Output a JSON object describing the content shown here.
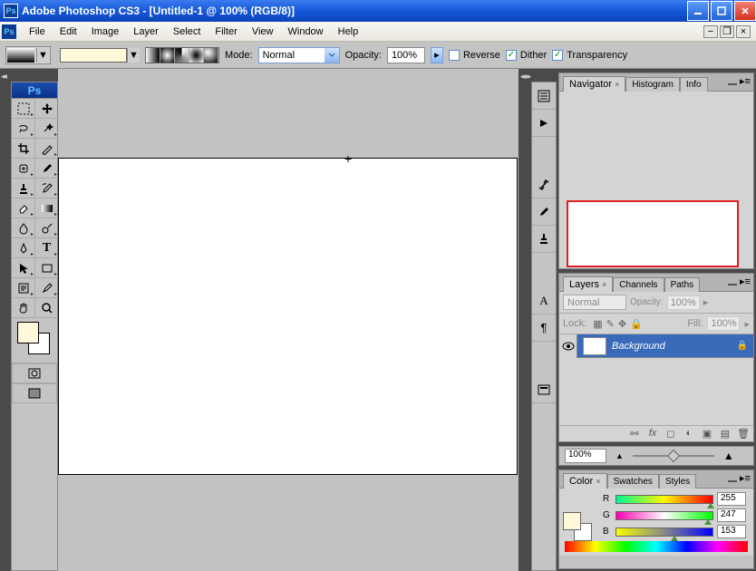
{
  "title": "Adobe Photoshop CS3 - [Untitled-1 @ 100% (RGB/8)]",
  "menu": [
    "File",
    "Edit",
    "Image",
    "Layer",
    "Select",
    "Filter",
    "View",
    "Window",
    "Help"
  ],
  "options": {
    "mode_label": "Mode:",
    "mode_value": "Normal",
    "opacity_label": "Opacity:",
    "opacity_value": "100%",
    "reverse": "Reverse",
    "dither": "Dither",
    "transparency": "Transparency"
  },
  "nav_tabs": [
    "Navigator",
    "Histogram",
    "Info"
  ],
  "layers_panel": {
    "tabs": [
      "Layers",
      "Channels",
      "Paths"
    ],
    "blend_mode": "Normal",
    "opacity_label": "Opacity:",
    "opacity_value": "100%",
    "lock_label": "Lock:",
    "fill_label": "Fill:",
    "fill_value": "100%",
    "layer_name": "Background"
  },
  "zoom": "100%",
  "color_panel": {
    "tabs": [
      "Color",
      "Swatches",
      "Styles"
    ],
    "r_label": "R",
    "g_label": "G",
    "b_label": "B",
    "r": "255",
    "g": "247",
    "b": "153"
  }
}
